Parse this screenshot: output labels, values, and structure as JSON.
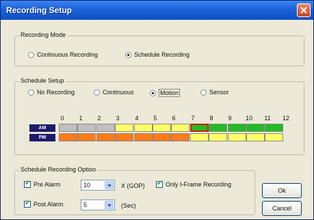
{
  "window": {
    "title": "Recording Setup"
  },
  "recording_mode": {
    "legend": "Recording Mode",
    "options": [
      {
        "label": "Continuous Recording",
        "selected": false
      },
      {
        "label": "Schedule Recording",
        "selected": true
      }
    ]
  },
  "schedule_setup": {
    "legend": "Schedule Setup",
    "options": [
      {
        "label": "No Recording",
        "selected": false
      },
      {
        "label": "Continuous",
        "selected": false
      },
      {
        "label": "Motion",
        "selected": true
      },
      {
        "label": "Sensor",
        "selected": false
      }
    ],
    "hours": [
      "0",
      "1",
      "2",
      "3",
      "4",
      "5",
      "6",
      "7",
      "8",
      "9",
      "10",
      "11",
      "12"
    ],
    "rows": [
      {
        "label": "AM",
        "cells": [
          "none",
          "none",
          "none",
          "motion",
          "motion",
          "motion",
          "motion",
          "selected",
          "continuous",
          "continuous",
          "continuous",
          "continuous"
        ]
      },
      {
        "label": "PM",
        "cells": [
          "continuous",
          "continuous",
          "continuous",
          "continuous",
          "continuous",
          "continuous",
          "continuous",
          "motion",
          "motion",
          "motion",
          "motion",
          "motion"
        ]
      }
    ],
    "colors": {
      "none": "#c0c0c0",
      "motion": "#ffff66",
      "continuous": "#ff7a1a",
      "green": "#22bb22",
      "selected_border": "#d21a1a"
    }
  },
  "schedule_option": {
    "legend": "Schedule Recording Option",
    "pre_alarm": {
      "label": "Pre Alarm",
      "checked": true,
      "value": "10",
      "unit": "X (GOP)"
    },
    "only_iframe": {
      "label": "Only I-Frame Recording",
      "checked": true
    },
    "post_alarm": {
      "label": "Post Alarm",
      "checked": true,
      "value": "5",
      "unit": "(Sec)"
    }
  },
  "buttons": {
    "ok": "Ok",
    "cancel": "Cancel"
  }
}
